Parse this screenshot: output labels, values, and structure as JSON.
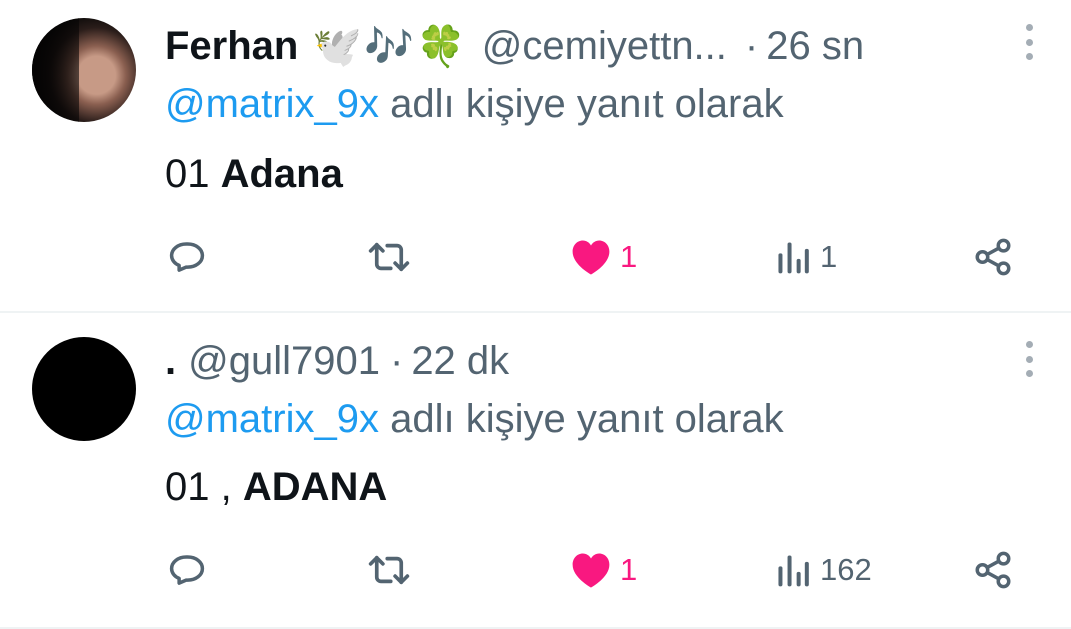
{
  "tweets": [
    {
      "name": "Ferhan",
      "emoji": "🕊️🎶🍀",
      "handle": "@cemiyettn...",
      "time": "26 sn",
      "reply_mention": "@matrix_9x",
      "reply_text": " adlı kişiye yanıt olarak",
      "body_plain": "01 ",
      "body_bold": "Adana",
      "likes": "1",
      "views": "1"
    },
    {
      "name": ".",
      "handle": "@gull7901",
      "time": "22 dk",
      "reply_mention": "@matrix_9x",
      "reply_text": " adlı kişiye yanıt olarak",
      "body_plain": "01 , ",
      "body_bold": "ADANA",
      "likes": "1",
      "views": "162"
    }
  ],
  "separator": "·",
  "icons": {
    "reply": "reply-icon",
    "retweet": "retweet-icon",
    "like": "heart-icon",
    "views": "views-icon",
    "share": "share-icon",
    "more": "more-icon"
  },
  "colors": {
    "mention": "#1d9bf0",
    "like": "#f91880",
    "secondary_text": "#536471"
  }
}
